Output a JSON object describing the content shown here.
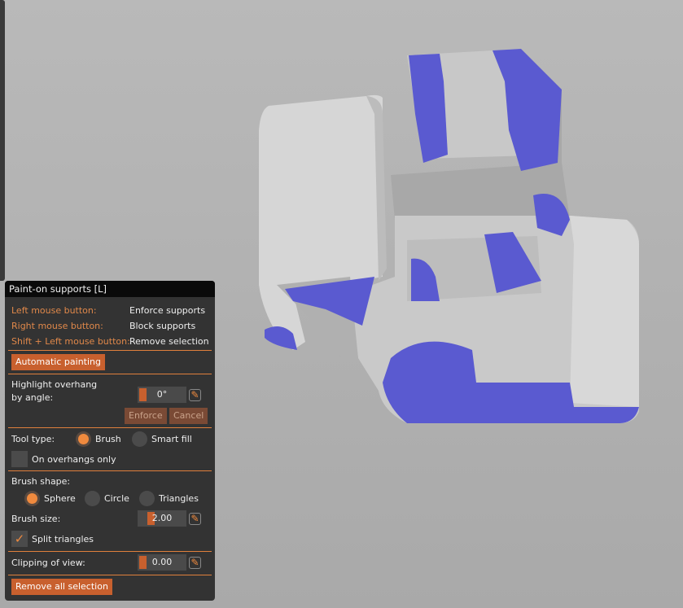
{
  "panel": {
    "title": "Paint-on supports [L]",
    "hints": [
      {
        "key": "Left mouse button:",
        "action": "Enforce supports"
      },
      {
        "key": "Right mouse button:",
        "action": "Block supports"
      },
      {
        "key": "Shift + Left mouse button:",
        "action": "Remove selection"
      }
    ],
    "automatic_painting": "Automatic painting",
    "highlight_label_1": "Highlight overhang",
    "highlight_label_2": "by angle:",
    "highlight_value": "0°",
    "enforce": "Enforce",
    "cancel": "Cancel",
    "tool_type_label": "Tool type:",
    "tool_brush": "Brush",
    "tool_smart_fill": "Smart fill",
    "tool_selected": "Brush",
    "overhangs_only": "On overhangs only",
    "overhangs_only_checked": false,
    "brush_shape_label": "Brush shape:",
    "shape_sphere": "Sphere",
    "shape_circle": "Circle",
    "shape_triangles": "Triangles",
    "shape_selected": "Sphere",
    "brush_size_label": "Brush size:",
    "brush_size": "2.00",
    "split_triangles": "Split triangles",
    "split_triangles_checked": true,
    "clipping_label": "Clipping of view:",
    "clipping_value": "0.00",
    "remove_all": "Remove all selection"
  },
  "colors": {
    "accent": "#c8602e",
    "enforcer": "#5a5ad0",
    "model": "#d2d2d2"
  }
}
